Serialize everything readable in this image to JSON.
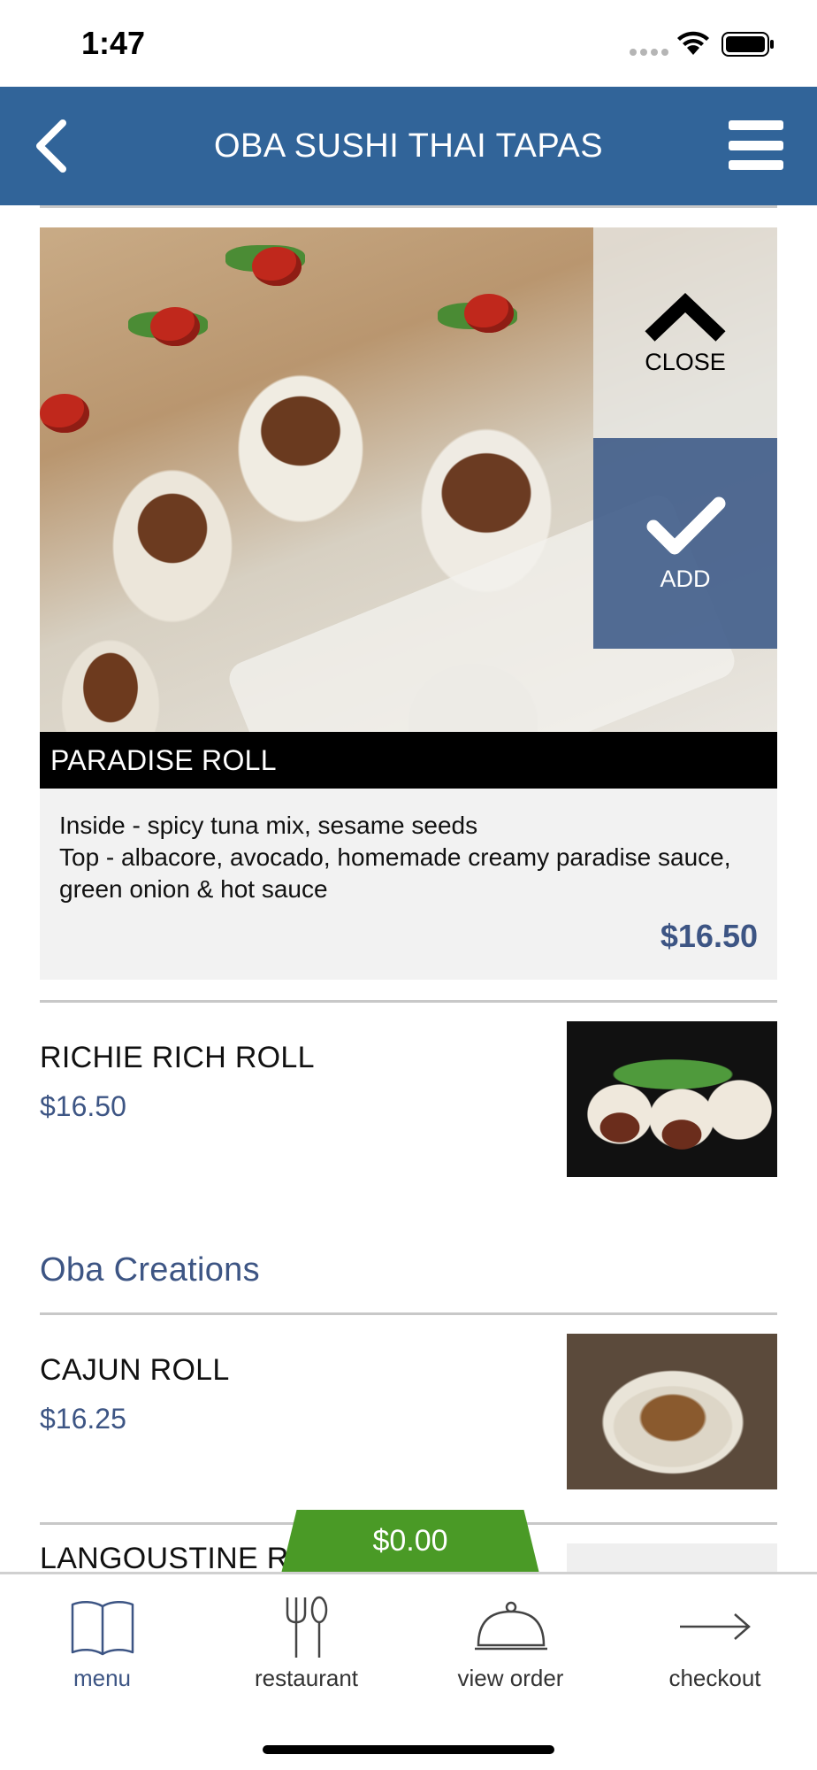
{
  "status_bar": {
    "time": "1:47"
  },
  "header": {
    "title": "OBA SUSHI THAI TAPAS"
  },
  "expanded_item": {
    "name": "PARADISE ROLL",
    "description": "Inside - spicy tuna mix, sesame seeds\nTop - albacore, avocado, homemade creamy paradise sauce, green onion & hot sauce",
    "price": "$16.50",
    "close_label": "CLOSE",
    "add_label": "ADD"
  },
  "items": [
    {
      "name": "RICHIE RICH ROLL",
      "price": "$16.50"
    }
  ],
  "sections": [
    {
      "heading": "Oba Creations",
      "items": [
        {
          "name": "CAJUN ROLL",
          "price": "$16.25"
        },
        {
          "name": "LANGOUSTINE R"
        }
      ]
    }
  ],
  "cart": {
    "total": "$0.00"
  },
  "tab_bar": {
    "tabs": [
      {
        "label": "menu",
        "icon": "book-icon",
        "active": true
      },
      {
        "label": "restaurant",
        "icon": "fork-spoon-icon",
        "active": false
      },
      {
        "label": "view order",
        "icon": "cloche-icon",
        "active": false
      },
      {
        "label": "checkout",
        "icon": "arrow-right-icon",
        "active": false
      }
    ]
  },
  "colors": {
    "header": "#316499",
    "accent": "#3d5584",
    "cart": "#4a9a26"
  }
}
